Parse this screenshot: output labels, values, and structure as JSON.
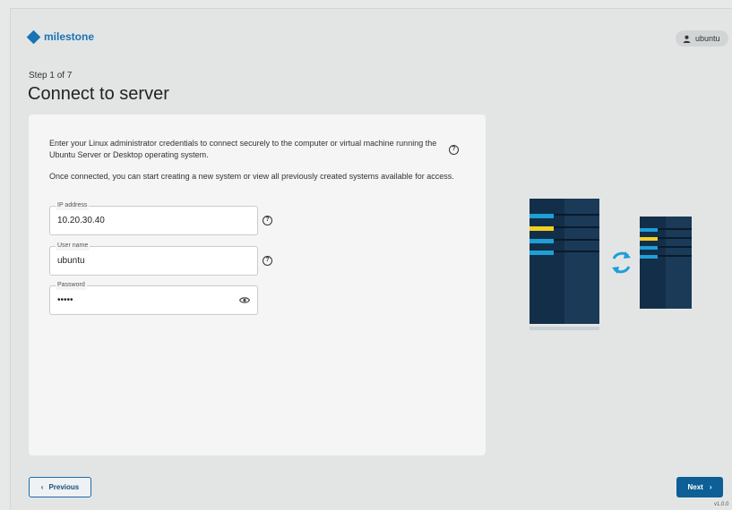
{
  "brand": {
    "name": "milestone",
    "color": "#1a73b5"
  },
  "user": {
    "name": "ubuntu",
    "icon": "user-icon"
  },
  "wizard": {
    "step_label": "Step 1 of 7",
    "title": "Connect to server",
    "intro": "Enter your Linux administrator credentials to connect securely to the computer or virtual machine running the Ubuntu Server or Desktop operating system.",
    "intro2": "Once connected, you can start creating a new system or view all previously created systems available for access."
  },
  "form": {
    "ip": {
      "label": "IP address",
      "value": "10.20.30.40"
    },
    "username": {
      "label": "User name",
      "value": "ubuntu"
    },
    "password": {
      "label": "Password",
      "value": "•••••"
    }
  },
  "help_icon": "?",
  "buttons": {
    "previous": "Previous",
    "next": "Next"
  },
  "version": "v1.0.0",
  "colors": {
    "primary": "#0d5f95",
    "accent_yellow": "#f2d024",
    "server_dark": "#16334f",
    "server_light": "#1e9fd8"
  }
}
